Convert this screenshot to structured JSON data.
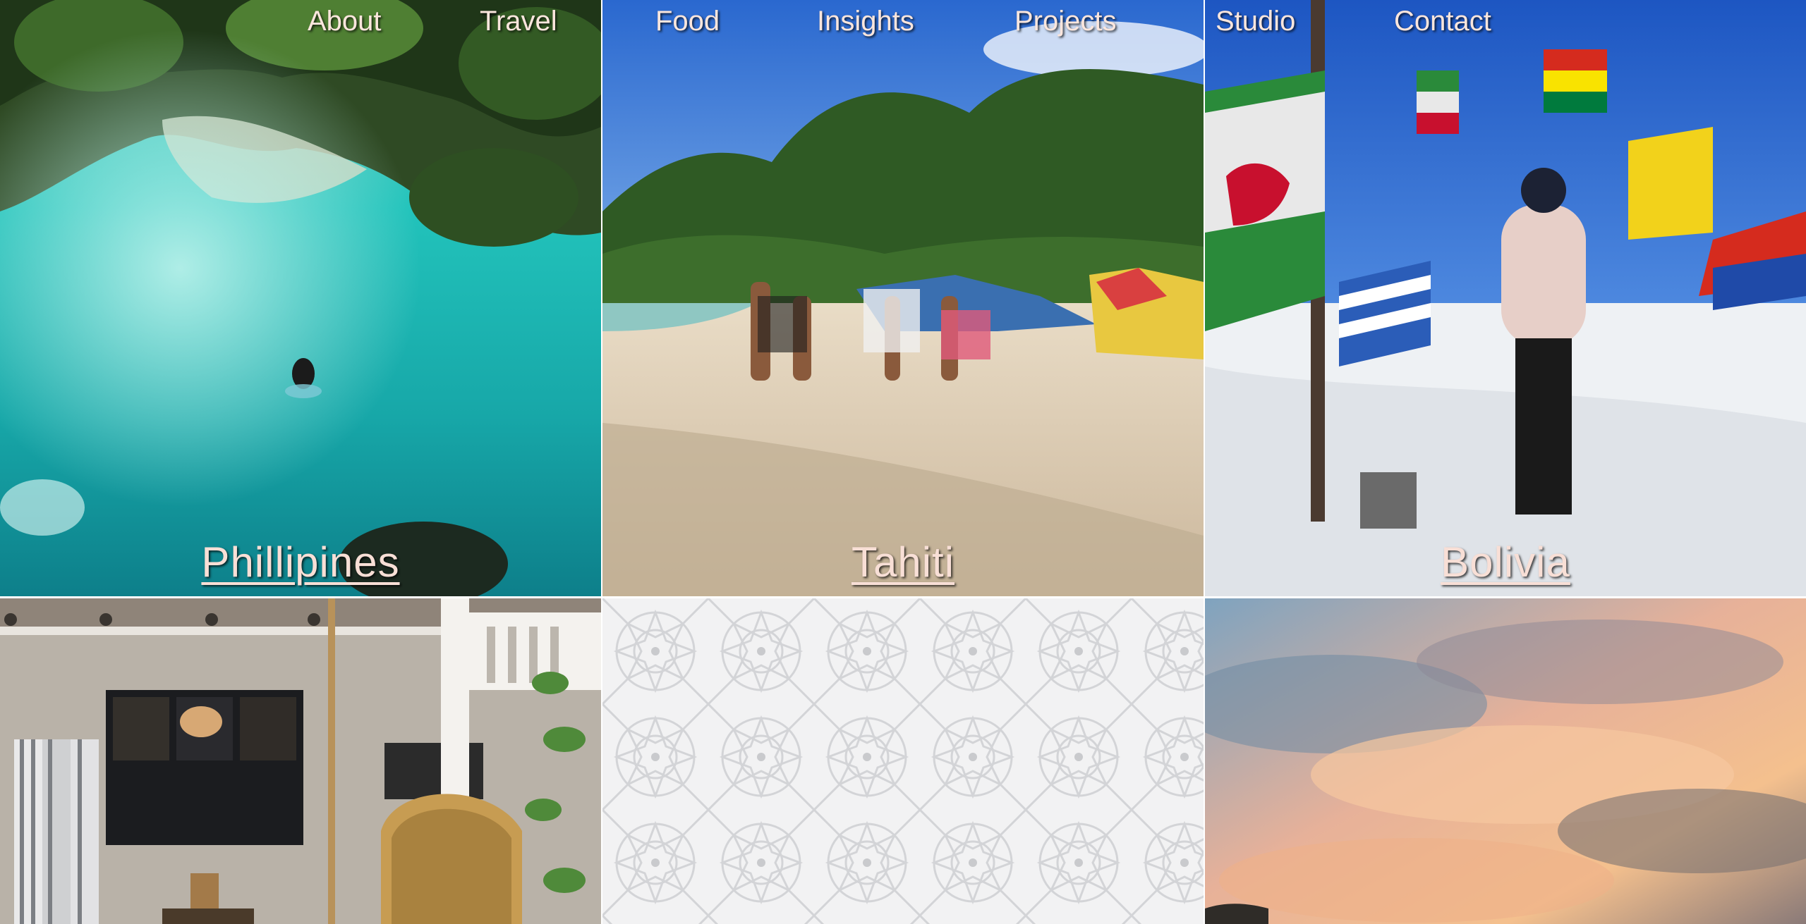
{
  "nav": {
    "items": [
      "About",
      "Travel",
      "Food",
      "Insights",
      "Projects",
      "Studio",
      "Contact"
    ]
  },
  "tiles": [
    {
      "label": "Phillipines",
      "scene": "turquoise river pool in jungle with swimmer"
    },
    {
      "label": "Tahiti",
      "scene": "beach group with kites and palm trees"
    },
    {
      "label": "Bolivia",
      "scene": "salt flat with international flags and woman in hoodie"
    },
    {
      "label": "",
      "scene": "porch with hanging towels and rattan swing chair"
    },
    {
      "label": "",
      "scene": "white geometric star lattice panel"
    },
    {
      "label": "",
      "scene": "sunset sky with pink clouds"
    }
  ],
  "colors": {
    "label_text": "#f8dfd6",
    "nav_text": "#fbe6dd",
    "water": "#1fb6b0",
    "sky": "#2f6fd0",
    "salt": "#eef1f4",
    "sunset": "#f4b88a"
  }
}
